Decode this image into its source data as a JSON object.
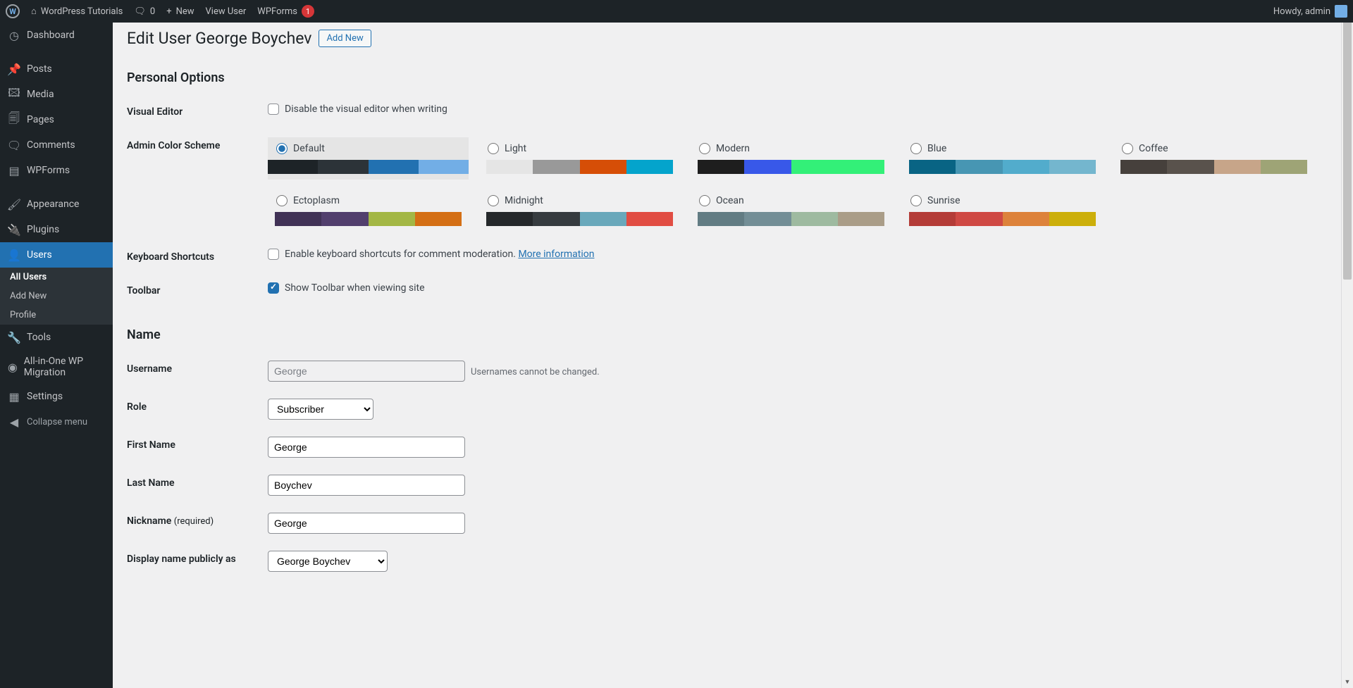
{
  "adminbar": {
    "site": "WordPress Tutorials",
    "comments": "0",
    "new": "New",
    "viewUser": "View User",
    "wpforms": "WPForms",
    "wpformsCount": "1",
    "howdy": "Howdy, admin"
  },
  "menu": {
    "dashboard": "Dashboard",
    "posts": "Posts",
    "media": "Media",
    "pages": "Pages",
    "comments": "Comments",
    "wpforms": "WPForms",
    "appearance": "Appearance",
    "plugins": "Plugins",
    "users": "Users",
    "tools": "Tools",
    "allinone": "All-in-One WP Migration",
    "settings": "Settings",
    "collapse": "Collapse menu",
    "sub": {
      "allUsers": "All Users",
      "addNew": "Add New",
      "profile": "Profile"
    }
  },
  "page": {
    "title": "Edit User George Boychev",
    "addNew": "Add New",
    "sections": {
      "personalOptions": "Personal Options",
      "name": "Name"
    }
  },
  "labels": {
    "visualEditor": "Visual Editor",
    "visualEditorDesc": "Disable the visual editor when writing",
    "adminColorScheme": "Admin Color Scheme",
    "keyboardShortcuts": "Keyboard Shortcuts",
    "keyboardShortcutsDesc": "Enable keyboard shortcuts for comment moderation.",
    "moreInfo": "More information",
    "toolbar": "Toolbar",
    "toolbarDesc": "Show Toolbar when viewing site",
    "username": "Username",
    "usernameNote": "Usernames cannot be changed.",
    "role": "Role",
    "firstName": "First Name",
    "lastName": "Last Name",
    "nickname": "Nickname",
    "required": "(required)",
    "displayName": "Display name publicly as"
  },
  "colorSchemes": [
    {
      "name": "Default",
      "colors": [
        "#1d2327",
        "#2c3338",
        "#2271b1",
        "#72aee6"
      ],
      "selected": true
    },
    {
      "name": "Light",
      "colors": [
        "#e5e5e5",
        "#999999",
        "#d64e07",
        "#04a4cc"
      ]
    },
    {
      "name": "Modern",
      "colors": [
        "#1e1e1e",
        "#3858e9",
        "#33f078",
        "#33f078"
      ]
    },
    {
      "name": "Blue",
      "colors": [
        "#096484",
        "#4796b3",
        "#52accc",
        "#74b6ce"
      ]
    },
    {
      "name": "Coffee",
      "colors": [
        "#46403c",
        "#59524c",
        "#c7a589",
        "#9ea476"
      ]
    },
    {
      "name": "Ectoplasm",
      "colors": [
        "#413256",
        "#523f6d",
        "#a3b745",
        "#d46f15"
      ]
    },
    {
      "name": "Midnight",
      "colors": [
        "#25282b",
        "#363b3f",
        "#69a8bb",
        "#e14d43"
      ]
    },
    {
      "name": "Ocean",
      "colors": [
        "#627c83",
        "#738e96",
        "#9ebaa0",
        "#aa9d88"
      ]
    },
    {
      "name": "Sunrise",
      "colors": [
        "#b43c38",
        "#cf4944",
        "#dd823b",
        "#ccaf0b"
      ]
    }
  ],
  "values": {
    "username": "George",
    "role": "Subscriber",
    "firstName": "George",
    "lastName": "Boychev",
    "nickname": "George",
    "displayName": "George Boychev",
    "toolbarChecked": true
  }
}
